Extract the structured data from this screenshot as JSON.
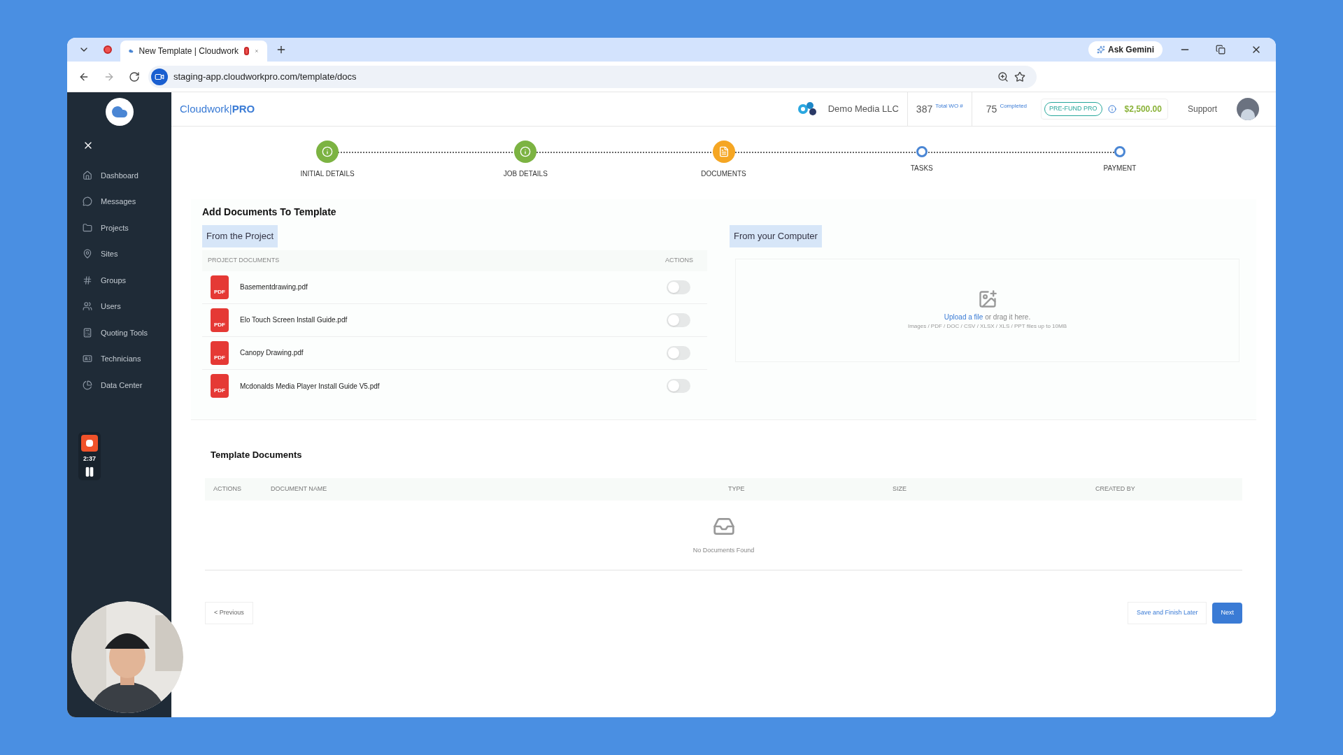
{
  "browser": {
    "tab_title": "New Template | Cloudwork",
    "ask_button": "Ask Gemini",
    "url": "staging-app.cloudworkpro.com/template/docs"
  },
  "app": {
    "brand": "Cloudwork|",
    "brand_suffix": "PRO",
    "company": "Demo Media LLC",
    "total_count": "387",
    "total_label": "Total WO #",
    "completed_count": "75",
    "completed_label": "Completed",
    "prefund_badge": "PRE-FUND PRO",
    "balance": "$2,500.00",
    "support": "Support"
  },
  "sidebar": {
    "items": [
      {
        "label": "Dashboard"
      },
      {
        "label": "Messages"
      },
      {
        "label": "Projects"
      },
      {
        "label": "Sites"
      },
      {
        "label": "Groups"
      },
      {
        "label": "Users"
      },
      {
        "label": "Quoting Tools"
      },
      {
        "label": "Technicians"
      },
      {
        "label": "Data Center"
      }
    ],
    "recorder": {
      "time": "2:37"
    }
  },
  "steps": [
    {
      "label": "INITIAL DETAILS",
      "kind": "done"
    },
    {
      "label": "JOB DETAILS",
      "kind": "done"
    },
    {
      "label": "DOCUMENTS",
      "kind": "current"
    },
    {
      "label": "TASKS",
      "kind": "pending"
    },
    {
      "label": "PAYMENT",
      "kind": "pending"
    }
  ],
  "add_section": {
    "title": "Add Documents To Template",
    "project_tab": "From the Project",
    "computer_tab": "From your Computer",
    "columns": [
      "PROJECT DOCUMENTS",
      "ACTIONS"
    ],
    "documents": [
      {
        "icon_text": "PDF",
        "name": "Basementdrawing.pdf",
        "on": false
      },
      {
        "icon_text": "PDF",
        "name": "Elo Touch Screen Install Guide.pdf",
        "on": false
      },
      {
        "icon_text": "PDF",
        "name": "Canopy Drawing.pdf",
        "on": false
      },
      {
        "icon_text": "PDF",
        "name": "Mcdonalds Media Player Install Guide V5.pdf",
        "on": false
      }
    ],
    "upload": {
      "link": "Upload a file",
      "rest": "or drag it here.",
      "hint": "Images / PDF / DOC / CSV / XLSX / XLS / PPT files up to 10MB"
    }
  },
  "template_documents": {
    "title": "Template Documents",
    "columns": [
      "ACTIONS",
      "DOCUMENT NAME",
      "TYPE",
      "SIZE",
      "CREATED BY"
    ],
    "empty": "No Documents Found"
  },
  "footer": {
    "previous": "< Previous",
    "save": "Save and Finish Later",
    "next": "Next"
  }
}
